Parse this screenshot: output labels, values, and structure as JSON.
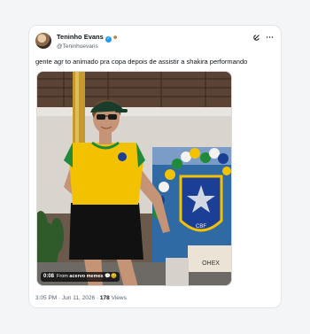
{
  "tweet": {
    "author": {
      "display_name": "Teninho Evans",
      "handle": "@Teninhoevans",
      "verified_icon": "verified-badge-icon",
      "extra_badge_icon": "cowboy-emoji-icon"
    },
    "text": "gente agr to animado pra copa depois de assistir a shakira performando",
    "media": {
      "timestamp": "0:08",
      "source_prefix": "From",
      "source_name": "acervo memes",
      "source_suffix": "💬🤐"
    },
    "time": "3:05 PM",
    "separator": "·",
    "date": "Jun 11, 2026",
    "views_count": "178",
    "views_label": "Views"
  },
  "icons": {
    "grok": "grok-icon",
    "more": "more-icon"
  },
  "colors": {
    "accent": "#1d9bf0",
    "text": "#0f1419",
    "muted": "#536471",
    "shirt_yellow": "#f2c200",
    "flag_green": "#1f8a3a",
    "flag_blue": "#1b3f94"
  }
}
